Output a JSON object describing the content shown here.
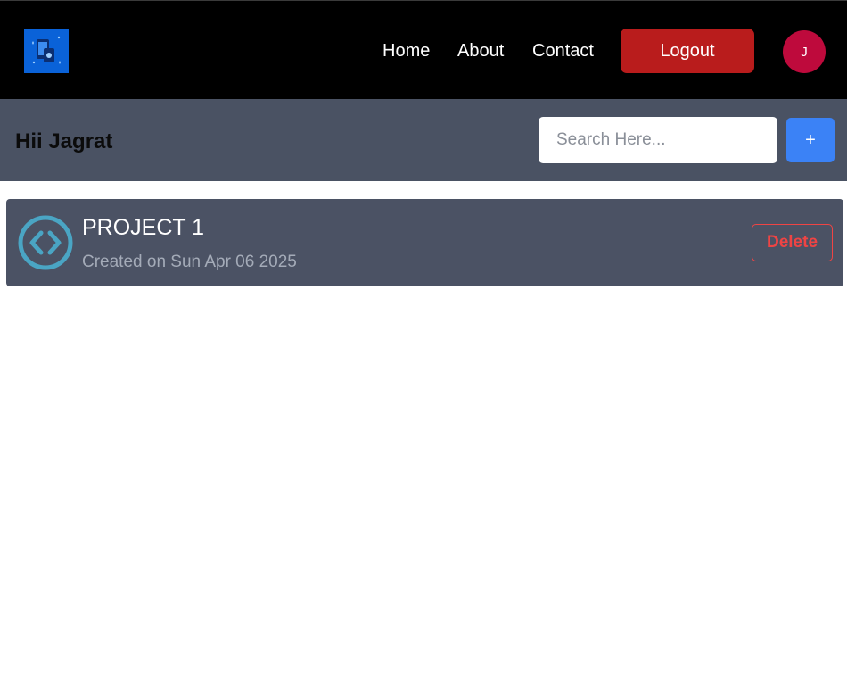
{
  "navbar": {
    "logo_icon": "app-logo-icon",
    "links": [
      {
        "label": "Home"
      },
      {
        "label": "About"
      },
      {
        "label": "Contact"
      }
    ],
    "logout_label": "Logout",
    "avatar_initial": "J"
  },
  "subheader": {
    "greeting": "Hii Jagrat",
    "search_placeholder": "Search Here...",
    "search_value": "",
    "add_label": "+"
  },
  "projects": [
    {
      "title": "PROJECT 1",
      "created": "Created on Sun Apr 06 2025",
      "icon": "code-icon",
      "delete_label": "Delete"
    }
  ],
  "colors": {
    "navbar_bg": "#000000",
    "subheader_bg": "#4a5263",
    "logout": "#b91c1c",
    "avatar": "#be0a3c",
    "add_button": "#3b82f6",
    "delete": "#ef4444",
    "code_icon": "#4aa5c4"
  }
}
